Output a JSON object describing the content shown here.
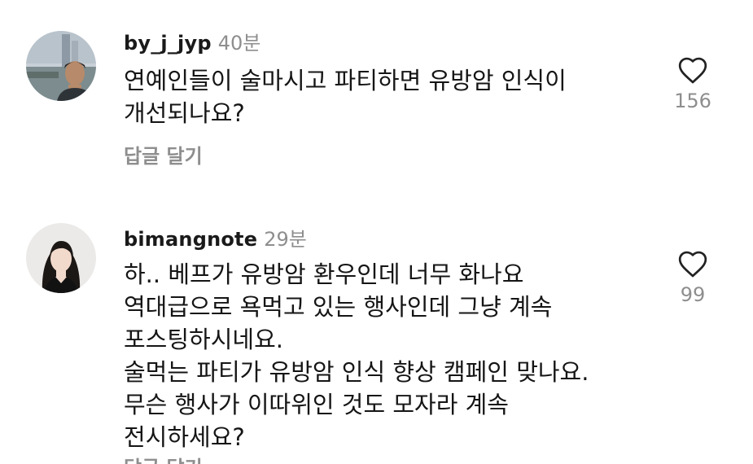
{
  "comments": [
    {
      "username": "by_j_jyp",
      "time": "40분",
      "lines": [
        "연예인들이 술마시고 파티하면 유방암 인식이",
        "개선되나요?"
      ],
      "likes": "156",
      "reply_label": "답글 달기",
      "avatar_icon": "avatar-man-photo"
    },
    {
      "username": "bimangnote",
      "time": "29분",
      "lines": [
        "하.. 베프가 유방암 환우인데 너무 화나요",
        "역대급으로 욕먹고 있는 행사인데 그냥 계속",
        "포스팅하시네요.",
        "술먹는 파티가 유방암 인식 향상 캠페인 맞나요.",
        "무슨 행사가 이따위인 것도 모자라 계속",
        "전시하세요?"
      ],
      "likes": "99",
      "reply_label": "답글 달기",
      "avatar_icon": "avatar-woman-photo"
    }
  ],
  "colors": {
    "text": "#151515",
    "muted": "#8e8e8e",
    "background": "#ffffff"
  },
  "icons": {
    "like": "heart-outline-icon"
  }
}
